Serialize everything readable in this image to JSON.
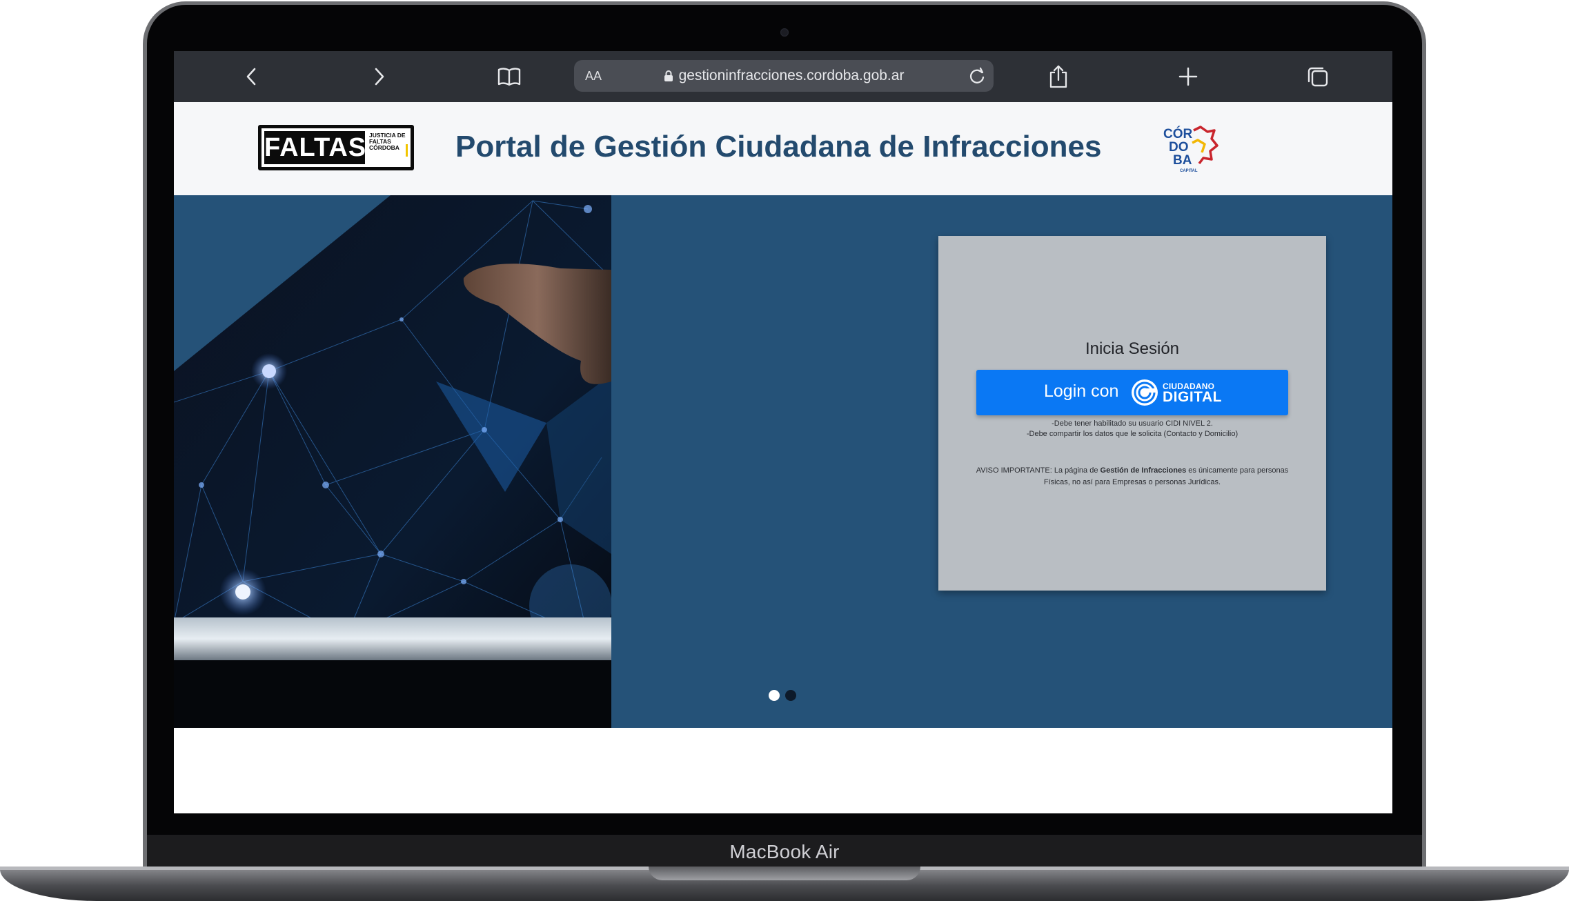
{
  "device": {
    "label": "MacBook Air"
  },
  "browser": {
    "text_size_button": "AA",
    "address": "gestioninfracciones.cordoba.gob.ar"
  },
  "header": {
    "faltas_logo": {
      "main": "FALTAS",
      "sub": "JUSTICIA DE FALTAS CÓRDOBA"
    },
    "title": "Portal de Gestión Ciudadana de Infracciones",
    "cordoba_logo": {
      "line1": "CÓR",
      "line2": "DO",
      "line3": "BA",
      "caption": "CAPITAL"
    }
  },
  "login": {
    "title": "Inicia Sesión",
    "button_label": "Login con",
    "cidi_top": "CIUDADANO",
    "cidi_bottom": "DIGITAL",
    "note_1": "-Debe tener habilitado su usuario CIDI NIVEL 2.",
    "note_2": "-Debe compartir los datos que le solicita (Contacto y Domicilio)",
    "warning_prefix": "AVISO IMPORTANTE: La página de",
    "warning_bold": "Gestión de Infracciones",
    "warning_suffix": "es únicamente para personas Físicas, no así para Empresas o personas Jurídicas."
  },
  "carousel": {
    "slide_count": 2,
    "active_slide": 1
  },
  "colors": {
    "header_title": "#234a6e",
    "hero_background": "#255278",
    "login_button": "#0a78f4",
    "card_background": "#b9bec3",
    "toolbar": "#2d3036"
  },
  "icons": [
    "back-icon",
    "forward-icon",
    "bookmarks-icon",
    "lock-icon",
    "reload-icon",
    "share-icon",
    "new-tab-icon",
    "tabs-icon",
    "cidi-logo-icon"
  ]
}
